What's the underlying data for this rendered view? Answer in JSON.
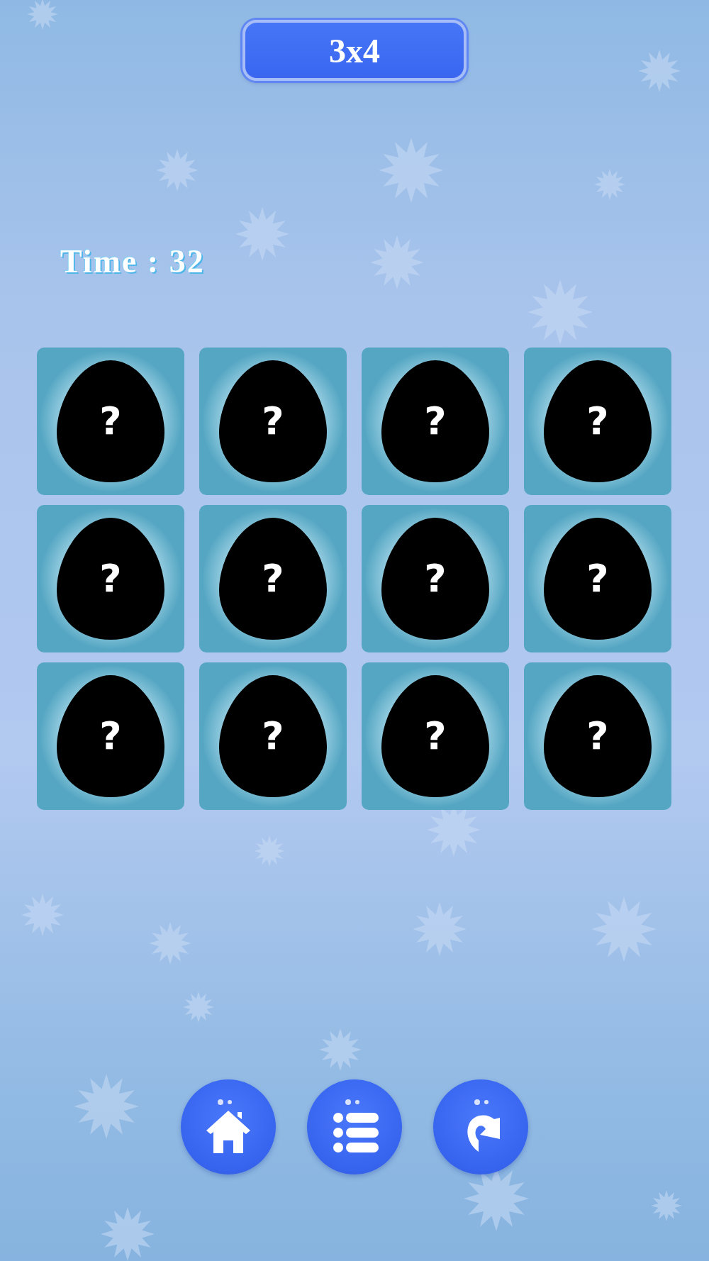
{
  "level_badge": "3x4",
  "timer": "Time : 32",
  "cards": [
    {
      "face": "?"
    },
    {
      "face": "?"
    },
    {
      "face": "?"
    },
    {
      "face": "?"
    },
    {
      "face": "?"
    },
    {
      "face": "?"
    },
    {
      "face": "?"
    },
    {
      "face": "?"
    },
    {
      "face": "?"
    },
    {
      "face": "?"
    },
    {
      "face": "?"
    },
    {
      "face": "?"
    }
  ],
  "buttons": [
    {
      "kind": "home"
    },
    {
      "kind": "list"
    },
    {
      "kind": "replay"
    }
  ]
}
